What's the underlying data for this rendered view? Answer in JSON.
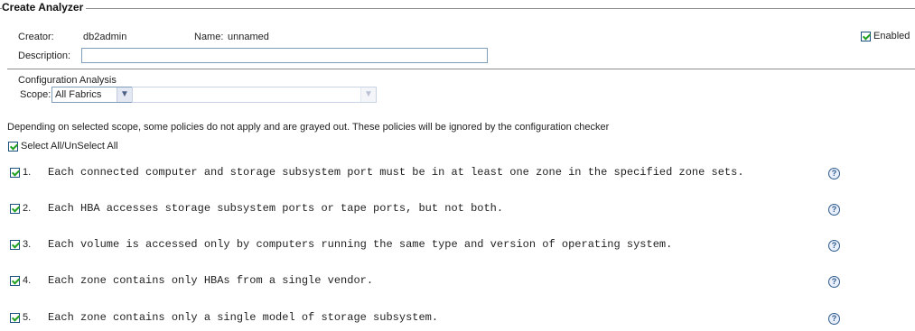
{
  "group": {
    "title": "Create Analyzer"
  },
  "creator": {
    "label": "Creator:",
    "value": "db2admin"
  },
  "name": {
    "label": "Name:",
    "value": "unnamed"
  },
  "enabled": {
    "label": "Enabled",
    "checked": true
  },
  "description": {
    "label": "Description:",
    "value": ""
  },
  "config": {
    "title": "Configuration Analysis",
    "scope_label": "Scope:",
    "scope_value": "All Fabrics",
    "second_value": ""
  },
  "note": "Depending on selected scope, some policies do not apply and are grayed out. These policies will be ignored by the configuration checker",
  "select_all": {
    "label": "Select All/UnSelect All",
    "checked": true
  },
  "policies": [
    {
      "number": "1.",
      "text": "Each connected computer and storage subsystem port must be in at least one zone in the specified zone sets.",
      "checked": true,
      "help": "?"
    },
    {
      "number": "2.",
      "text": "Each HBA accesses storage subsystem ports or tape ports, but not both.",
      "checked": true,
      "help": "?"
    },
    {
      "number": "3.",
      "text": "Each volume is accessed only by computers running the same type and version of operating system.",
      "checked": true,
      "help": "?"
    },
    {
      "number": "4.",
      "text": "Each zone contains only HBAs from a single vendor.",
      "checked": true,
      "help": "?"
    },
    {
      "number": "5.",
      "text": "Each zone contains only a single model of storage subsystem.",
      "checked": true,
      "help": "?"
    }
  ],
  "icons": {
    "checkbox": "checkmark-icon",
    "dropdown": "chevron-down-icon",
    "help": "help-icon"
  },
  "colors": {
    "border": "#7f9db9",
    "check": "#21a121",
    "help": "#2f5a8c"
  }
}
